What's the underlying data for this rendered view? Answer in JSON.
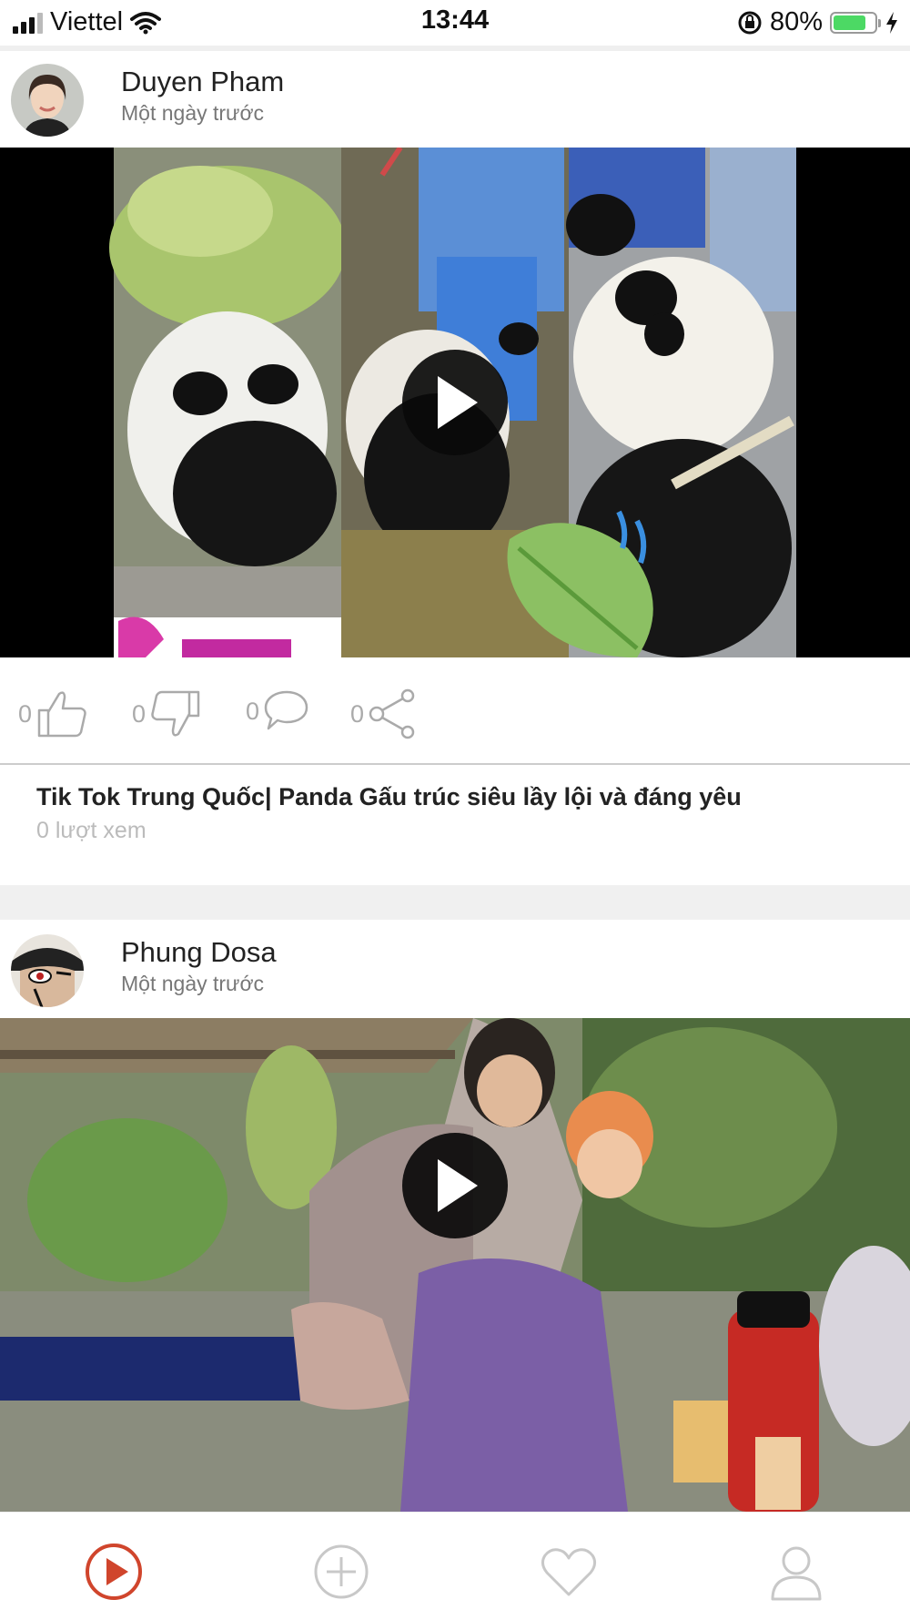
{
  "status_bar": {
    "carrier": "Viettel",
    "time": "13:44",
    "battery": "80%",
    "battery_level": 0.8,
    "accent": "#4cd964"
  },
  "posts": [
    {
      "author": "Duyen Pham",
      "time": "Một ngày trước",
      "likes": "0",
      "dislikes": "0",
      "comments": "0",
      "shares": "0",
      "title": "Tik Tok Trung Quốc| Panda Gấu trúc siêu lầy lội và đáng yêu",
      "views": "0 lượt xem"
    },
    {
      "author": "Phung Dosa",
      "time": "Một ngày trước"
    }
  ],
  "tabbar": {
    "items": [
      "play-icon",
      "plus-icon",
      "heart-icon",
      "user-icon"
    ],
    "active_color": "#d0452c",
    "inactive_color": "#c8c8c8"
  }
}
